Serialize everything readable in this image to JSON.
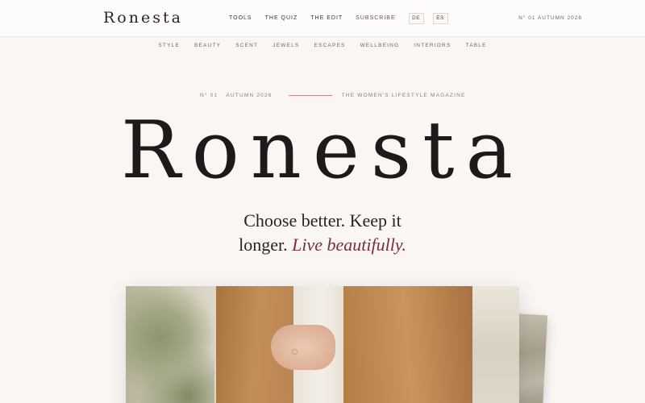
{
  "brand": {
    "logo": "Ronesta"
  },
  "topnav": {
    "items": [
      "TOOLS",
      "THE QUIZ",
      "THE EDIT",
      "SUBSCRIBE"
    ],
    "languages": [
      "DE",
      "ES"
    ],
    "issue": "N° 01   AUTUMN 2026"
  },
  "subnav": {
    "items": [
      "STYLE",
      "BEAUTY",
      "SCENT",
      "JEWELS",
      "ESCAPES",
      "WELLBEING",
      "INTERIORS",
      "TABLE"
    ]
  },
  "hero": {
    "issue_number": "N° 01",
    "season": "AUTUMN 2026",
    "kicker": "THE WOMEN'S LIFESTYLE MAGAZINE",
    "title": "Ronesta",
    "tagline_line1": "Choose better. Keep it",
    "tagline_line2": "longer.",
    "tagline_emphasis": "Live beautifully."
  },
  "colors": {
    "accent": "#7a2e3f",
    "background": "#f9f6f3",
    "text": "#2b2422"
  }
}
